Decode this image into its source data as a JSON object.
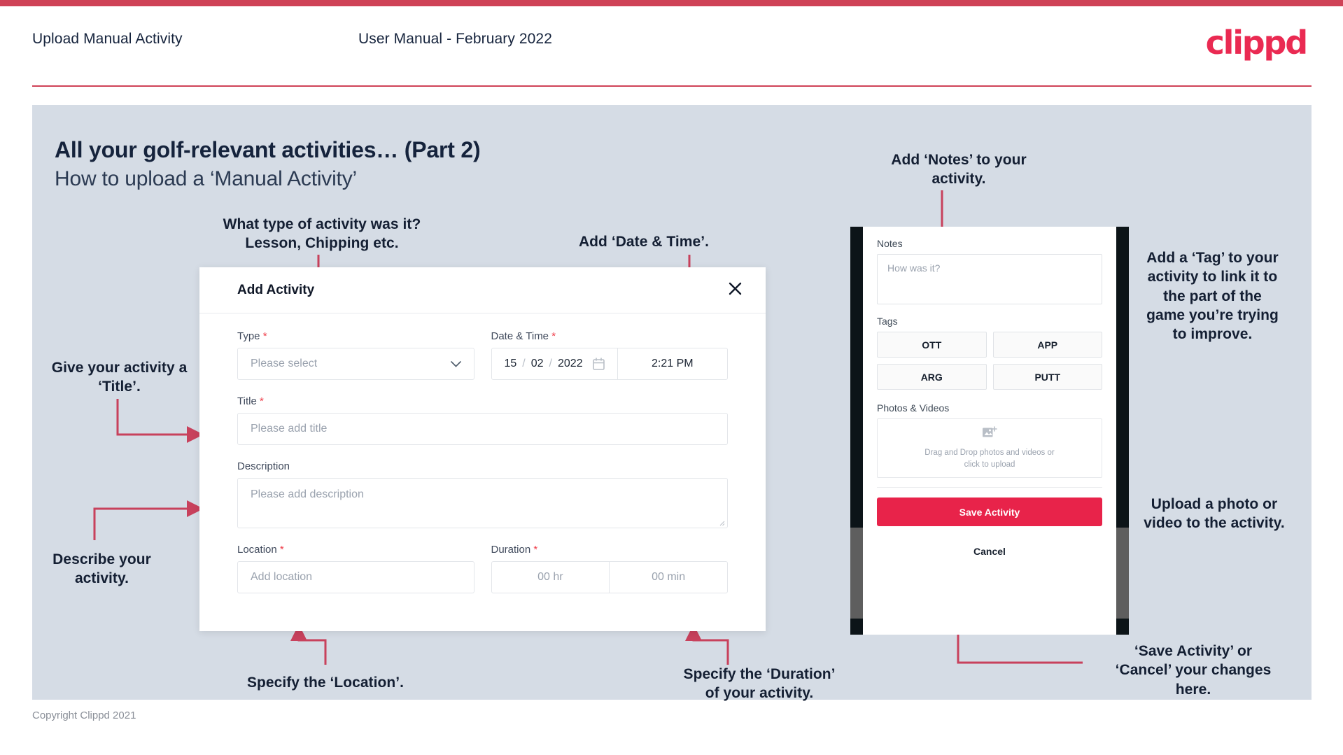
{
  "header": {
    "title": "Upload Manual Activity",
    "subtitle": "User Manual - February 2022",
    "logo": "clippd"
  },
  "slide": {
    "heading": "All your golf-relevant activities… (Part 2)",
    "subheading": "How to upload a ‘Manual Activity’"
  },
  "annotations": {
    "type": "What type of activity was it?\nLesson, Chipping etc.",
    "datetime": "Add ‘Date & Time’.",
    "title": "Give your activity a\n‘Title’.",
    "description": "Describe your\nactivity.",
    "location": "Specify the ‘Location’.",
    "duration": "Specify the ‘Duration’\nof your activity.",
    "notes": "Add ‘Notes’ to your\nactivity.",
    "tag": "Add a ‘Tag’ to your\nactivity to link it to\nthe part of the\ngame you’re trying\nto improve.",
    "upload": "Upload a photo or\nvideo to the activity.",
    "save_cancel": "‘Save Activity’ or\n‘Cancel’ your changes\nhere."
  },
  "dialog": {
    "title": "Add Activity",
    "close_icon": "close-icon",
    "fields": {
      "type": {
        "label": "Type",
        "required": "*",
        "placeholder": "Please select",
        "chevron": "chevron-down-icon"
      },
      "datetime": {
        "label": "Date & Time",
        "required": "*",
        "day": "15",
        "month": "02",
        "year": "2022",
        "separator": "/",
        "calendar_icon": "calendar-icon",
        "time": "2:21 PM"
      },
      "title": {
        "label": "Title",
        "required": "*",
        "placeholder": "Please add title"
      },
      "description": {
        "label": "Description",
        "required": "",
        "placeholder": "Please add description"
      },
      "location": {
        "label": "Location",
        "required": "*",
        "placeholder": "Add location"
      },
      "duration": {
        "label": "Duration",
        "required": "*",
        "hours_placeholder": "00 hr",
        "minutes_placeholder": "00 min"
      }
    }
  },
  "phone": {
    "notes": {
      "label": "Notes",
      "placeholder": "How was it?"
    },
    "tags": {
      "label": "Tags",
      "items": [
        "OTT",
        "APP",
        "ARG",
        "PUTT"
      ]
    },
    "photos": {
      "label": "Photos & Videos",
      "icon": "add-image-icon",
      "drop_line1": "Drag and Drop photos and videos or",
      "drop_line2": "click to upload"
    },
    "save_label": "Save Activity",
    "cancel_label": "Cancel"
  },
  "footer": {
    "copyright": "Copyright Clippd 2021"
  },
  "colors": {
    "brand_pink": "#ea2a52",
    "strip": "#cf4257",
    "panel_bg": "#d5dce5",
    "annotation_line": "#c8415c",
    "save_button": "#e8234a",
    "text_dark": "#15233c",
    "required_red": "#ef3e4a"
  }
}
